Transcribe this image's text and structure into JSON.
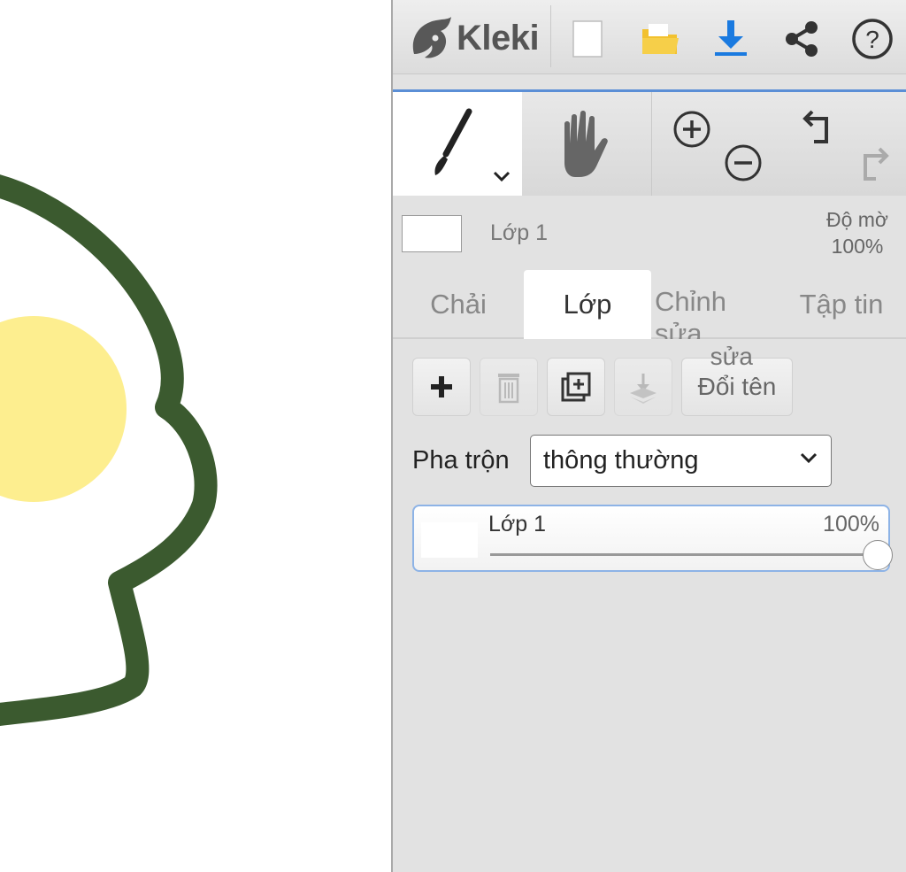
{
  "app": {
    "name": "Kleki"
  },
  "layer_info": {
    "name": "Lớp 1",
    "opacity_label": "Độ mờ",
    "opacity_value": "100%"
  },
  "tabs": [
    {
      "label": "Chải",
      "active": false
    },
    {
      "label": "Lớp",
      "active": true
    },
    {
      "label": "Chỉnh sửa",
      "active": false
    },
    {
      "label": "Tập tin",
      "active": false
    }
  ],
  "layer_buttons": {
    "rename_label": "Đổi tên",
    "overlap_text": "sửa"
  },
  "blend": {
    "label": "Pha trộn",
    "selected": "thông thường"
  },
  "layers": [
    {
      "name": "Lớp 1",
      "opacity": "100%",
      "opacity_fraction": 1.0
    }
  ],
  "colors": {
    "stroke": "#3b5a2f",
    "fill": "#fdee8f",
    "accent": "#5b8fd6",
    "download": "#1a7ae0",
    "folder": "#f2c12e"
  },
  "icons": {
    "new": "new-file-icon",
    "open": "folder-icon",
    "save": "download-icon",
    "share": "share-icon",
    "help": "help-icon",
    "brush": "brush-icon",
    "hand": "hand-icon",
    "zoom_in": "zoom-in-icon",
    "zoom_out": "zoom-out-icon",
    "undo": "undo-icon",
    "redo": "redo-icon",
    "add": "plus-icon",
    "delete": "trash-icon",
    "duplicate": "duplicate-icon",
    "merge": "merge-down-icon"
  }
}
